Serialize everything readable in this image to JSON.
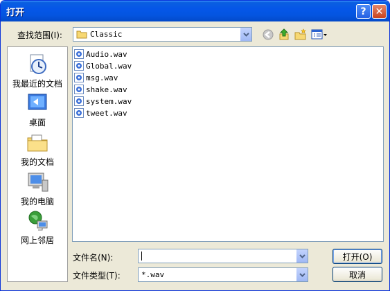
{
  "window": {
    "title": "打开"
  },
  "titlebar": {
    "help_glyph": "?",
    "close_glyph": "✕"
  },
  "lookin": {
    "label": "查找范围(I):",
    "value": "Classic"
  },
  "toolbar": {
    "icons": [
      "back-icon",
      "up-folder-icon",
      "new-folder-icon",
      "view-menu-icon"
    ]
  },
  "places": [
    {
      "label": "我最近的文档",
      "icon": "recent-documents-icon"
    },
    {
      "label": "桌面",
      "icon": "desktop-icon"
    },
    {
      "label": "我的文档",
      "icon": "my-documents-icon"
    },
    {
      "label": "我的电脑",
      "icon": "my-computer-icon"
    },
    {
      "label": "网上邻居",
      "icon": "network-places-icon"
    }
  ],
  "files": [
    "Audio.wav",
    "Global.wav",
    "msg.wav",
    "shake.wav",
    "system.wav",
    "tweet.wav"
  ],
  "filename": {
    "label": "文件名(N):",
    "value": ""
  },
  "filetype": {
    "label": "文件类型(T):",
    "value": "*.wav"
  },
  "buttons": {
    "open": "打开(O)",
    "cancel": "取消"
  },
  "colors": {
    "titlebar": "#0556e8",
    "dialog_bg": "#ece9d8",
    "field_border": "#7f9db9"
  }
}
